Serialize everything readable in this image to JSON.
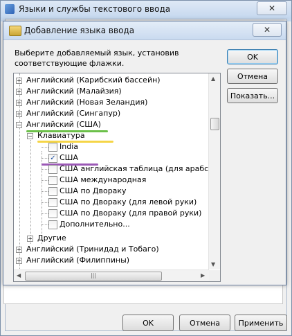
{
  "outer_window": {
    "title": "Языки и службы текстового ввода",
    "close_glyph": "✕",
    "buttons": {
      "ok": "OK",
      "cancel": "Отмена",
      "apply": "Применить"
    }
  },
  "dialog": {
    "title": "Добавление языка ввода",
    "close_glyph": "✕",
    "instructions": "Выберите добавляемый язык, установив соответствующие флажки.",
    "buttons": {
      "ok": "OK",
      "cancel": "Отмена",
      "preview": "Показать..."
    }
  },
  "tree": {
    "items": [
      {
        "label": "Английский (Карибский бассейн)",
        "expander": "+"
      },
      {
        "label": "Английский (Малайзия)",
        "expander": "+"
      },
      {
        "label": "Английский (Новая Зеландия)",
        "expander": "+"
      },
      {
        "label": "Английский (Сингапур)",
        "expander": "+"
      },
      {
        "label": "Английский (США)",
        "expander": "−"
      },
      {
        "label": "Клавиатура",
        "expander": "−"
      },
      {
        "label": "India",
        "checked": false
      },
      {
        "label": "США",
        "checked": true
      },
      {
        "label": "США английская таблица (для арабск",
        "checked": false
      },
      {
        "label": "США международная",
        "checked": false
      },
      {
        "label": "США по Двораку",
        "checked": false
      },
      {
        "label": "США по Двораку (для левой руки)",
        "checked": false
      },
      {
        "label": "США по Двораку (для правой руки)",
        "checked": false
      },
      {
        "label": "Дополнительно...",
        "checked": false
      },
      {
        "label": "Другие",
        "expander": "+"
      },
      {
        "label": "Английский (Тринидад и Тобаго)",
        "expander": "+"
      },
      {
        "label": "Английский (Филиппины)",
        "expander": "+"
      }
    ],
    "check_glyph": "✓",
    "scroll_up": "▲",
    "scroll_down": "▼",
    "scroll_left": "◀",
    "scroll_right": "▶",
    "hscroll_grip": "|||"
  },
  "annotations": {
    "usa_underline_color": "#6cc04a",
    "keyboard_underline_color": "#f5d547",
    "usa_layout_underline_color": "#9b59b6"
  }
}
